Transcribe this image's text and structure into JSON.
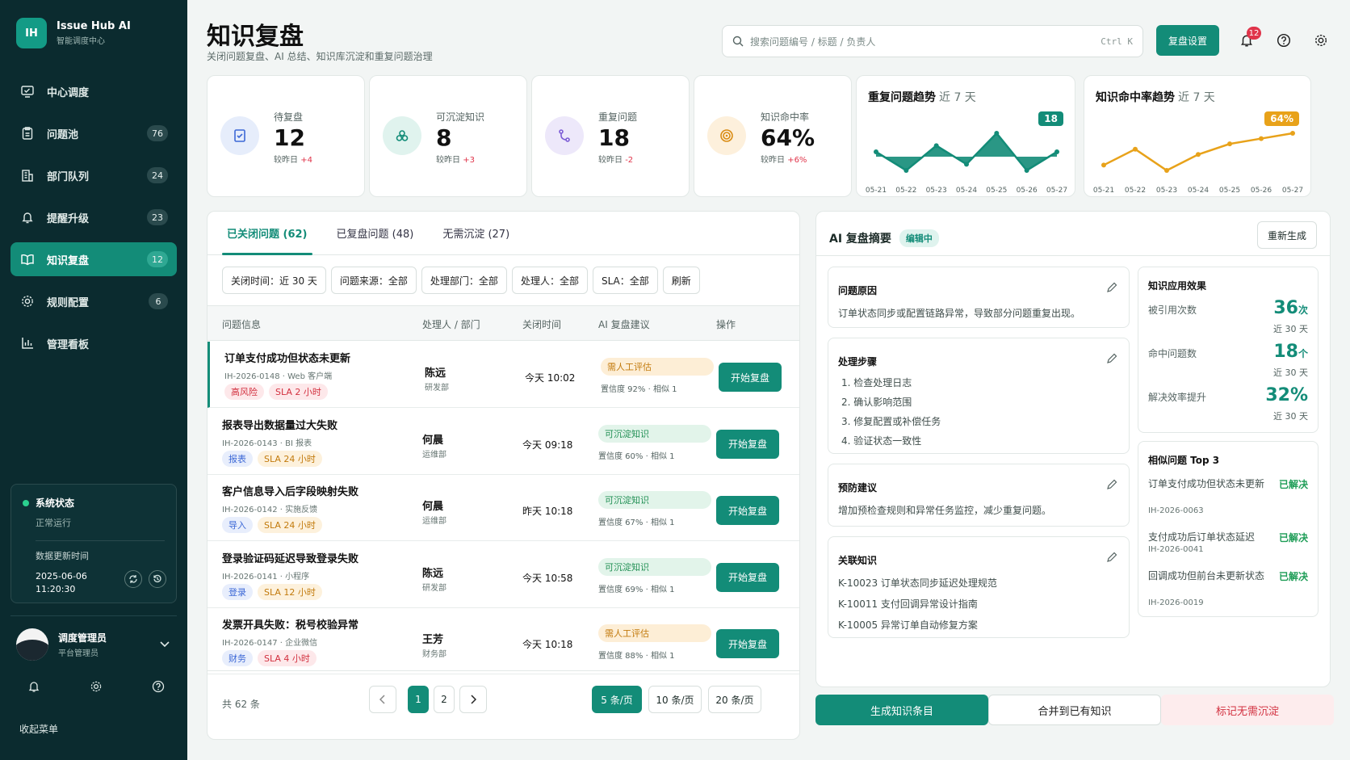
{
  "brand": {
    "logo": "IH",
    "name": "Issue Hub AI",
    "subtitle": "智能调度中心"
  },
  "nav": [
    {
      "label": "中心调度",
      "icon": "monitor-icon",
      "badge": ""
    },
    {
      "label": "问题池",
      "icon": "clipboard-icon",
      "badge": "76"
    },
    {
      "label": "部门队列",
      "icon": "building-icon",
      "badge": "24"
    },
    {
      "label": "提醒升级",
      "icon": "bell-icon",
      "badge": "23"
    },
    {
      "label": "知识复盘",
      "icon": "book-icon",
      "badge": "12",
      "active": true
    },
    {
      "label": "规则配置",
      "icon": "gear-icon",
      "badge": "6"
    },
    {
      "label": "管理看板",
      "icon": "bar-chart-icon",
      "badge": ""
    }
  ],
  "system": {
    "title": "系统状态",
    "status": "正常运行",
    "update_label": "数据更新时间",
    "update_time": "2025-06-06 11:20:30"
  },
  "user": {
    "name": "调度管理员",
    "role": "平台管理员"
  },
  "collapse_label": "收起菜单",
  "page": {
    "title": "知识复盘",
    "subtitle": "关闭问题复盘、AI 总结、知识库沉淀和重复问题治理"
  },
  "search": {
    "placeholder": "搜索问题编号 / 标题 / 负责人",
    "shortcut": "Ctrl K"
  },
  "header": {
    "settings_button": "复盘设置",
    "notif_count": "12"
  },
  "stats": [
    {
      "label": "待复盘",
      "value": "12",
      "delta_prefix": "较昨日",
      "delta": "+4",
      "color": "#e6edfb",
      "ic": "#3c68d6",
      "icon": "checklist-icon"
    },
    {
      "label": "可沉淀知识",
      "value": "8",
      "delta_prefix": "较昨日",
      "delta": "+3",
      "color": "#e0f3ee",
      "ic": "#138c78",
      "icon": "cubes-icon"
    },
    {
      "label": "重复问题",
      "value": "18",
      "delta_prefix": "较昨日",
      "delta": "-2",
      "color": "#ede8fa",
      "ic": "#7c5cd6",
      "icon": "branch-icon"
    },
    {
      "label": "知识命中率",
      "value": "64%",
      "delta_prefix": "较昨日",
      "delta": "+6%",
      "color": "#fdf0dc",
      "ic": "#d98b12",
      "icon": "target-icon"
    }
  ],
  "trends": [
    {
      "title": "重复问题趋势",
      "range": "近 7 天",
      "badge": "18",
      "color": "#138c78",
      "dates": [
        "05-21",
        "05-22",
        "05-23",
        "05-24",
        "05-25",
        "05-26",
        "05-27"
      ],
      "values": [
        15,
        12,
        16,
        13,
        18,
        12,
        15
      ]
    },
    {
      "title": "知识命中率趋势",
      "range": "近 7 天",
      "badge": "64%",
      "color": "#e8a21a",
      "dates": [
        "05-21",
        "05-22",
        "05-23",
        "05-24",
        "05-25",
        "05-26",
        "05-27"
      ],
      "values": [
        58,
        61,
        57,
        60,
        62,
        63,
        64
      ]
    }
  ],
  "tabs": [
    "已关闭问题 (62)",
    "已复盘问题 (48)",
    "无需沉淀 (27)"
  ],
  "filters": [
    "关闭时间：近 30 天",
    "问题来源：全部",
    "处理部门：全部",
    "处理人：全部",
    "SLA：全部",
    "刷新"
  ],
  "columns": [
    "问题信息",
    "处理人 / 部门",
    "关闭时间",
    "AI 复盘建议",
    "操作"
  ],
  "rows": [
    {
      "title": "订单支付成功但状态未更新",
      "meta": "IH-2026-0148 · Web 客户端",
      "tag1": "高风险",
      "tag1c": "red",
      "tag2": "SLA 2 小时",
      "tag2c": "red",
      "who": "陈远",
      "dept": "研发部",
      "time": "今天 10:02",
      "sugg": "需人工评估",
      "sc": "org",
      "conf": "置信度 92% · 相似 1",
      "action": "开始复盘"
    },
    {
      "title": "报表导出数据量过大失败",
      "meta": "IH-2026-0143 · BI 报表",
      "tag1": "报表",
      "tag1c": "blue",
      "tag2": "SLA 24 小时",
      "tag2c": "org",
      "who": "何晨",
      "dept": "运维部",
      "time": "今天 09:18",
      "sugg": "可沉淀知识",
      "sc": "grn",
      "conf": "置信度 60% · 相似 1",
      "action": "开始复盘"
    },
    {
      "title": "客户信息导入后字段映射失败",
      "meta": "IH-2026-0142 · 实施反馈",
      "tag1": "导入",
      "tag1c": "blue",
      "tag2": "SLA 24 小时",
      "tag2c": "org",
      "who": "何晨",
      "dept": "运维部",
      "time": "昨天 10:18",
      "sugg": "可沉淀知识",
      "sc": "grn",
      "conf": "置信度 67% · 相似 1",
      "action": "开始复盘"
    },
    {
      "title": "登录验证码延迟导致登录失败",
      "meta": "IH-2026-0141 · 小程序",
      "tag1": "登录",
      "tag1c": "blue",
      "tag2": "SLA 12 小时",
      "tag2c": "org",
      "who": "陈远",
      "dept": "研发部",
      "time": "今天 10:58",
      "sugg": "可沉淀知识",
      "sc": "grn",
      "conf": "置信度 69% · 相似 1",
      "action": "开始复盘"
    },
    {
      "title": "发票开具失败：税号校验异常",
      "meta": "IH-2026-0147 · 企业微信",
      "tag1": "财务",
      "tag1c": "blue",
      "tag2": "SLA 4 小时",
      "tag2c": "red",
      "who": "王芳",
      "dept": "财务部",
      "time": "今天 10:18",
      "sugg": "需人工评估",
      "sc": "org",
      "conf": "置信度 88% · 相似 1",
      "action": "开始复盘"
    }
  ],
  "pager": {
    "total": "共 62 条",
    "pages": [
      "1",
      "2"
    ],
    "sizes": [
      "5 条/页",
      "10 条/页",
      "20 条/页"
    ]
  },
  "ai": {
    "title": "AI 复盘摘要",
    "badge": "编辑中",
    "regen": "重新生成",
    "cause_title": "问题原因",
    "cause": "订单状态同步或配置链路异常，导致部分问题重复出现。",
    "steps_title": "处理步骤",
    "steps": [
      "1. 检查处理日志",
      "2. 确认影响范围",
      "3. 修复配置或补偿任务",
      "4. 验证状态一致性"
    ],
    "prevent_title": "预防建议",
    "prevent": "增加预检查规则和异常任务监控，减少重复问题。",
    "links_title": "关联知识",
    "links": [
      "K-10023 订单状态同步延迟处理规范",
      "K-10011 支付回调异常设计指南",
      "K-10005 异常订单自动修复方案"
    ]
  },
  "effect": {
    "title": "知识应用效果",
    "items": [
      {
        "label": "被引用次数",
        "value": "36",
        "unit": "次",
        "sub": "近 30 天"
      },
      {
        "label": "命中问题数",
        "value": "18",
        "unit": "个",
        "sub": "近 30 天"
      },
      {
        "label": "解决效率提升",
        "value": "32%",
        "unit": "",
        "sub": "近 30 天"
      }
    ]
  },
  "similar": {
    "title": "相似问题 Top 3",
    "items": [
      {
        "title": "订单支付成功但状态未更新",
        "id": "IH-2026-0063",
        "status": "已解决"
      },
      {
        "title": "支付成功后订单状态延迟",
        "id": "IH-2026-0041",
        "status": "已解决"
      },
      {
        "title": "回调成功但前台未更新状态",
        "id": "IH-2026-0019",
        "status": "已解决"
      }
    ]
  },
  "bottom": {
    "generate": "生成知识条目",
    "merge": "合并到已有知识",
    "skip": "标记无需沉淀"
  }
}
